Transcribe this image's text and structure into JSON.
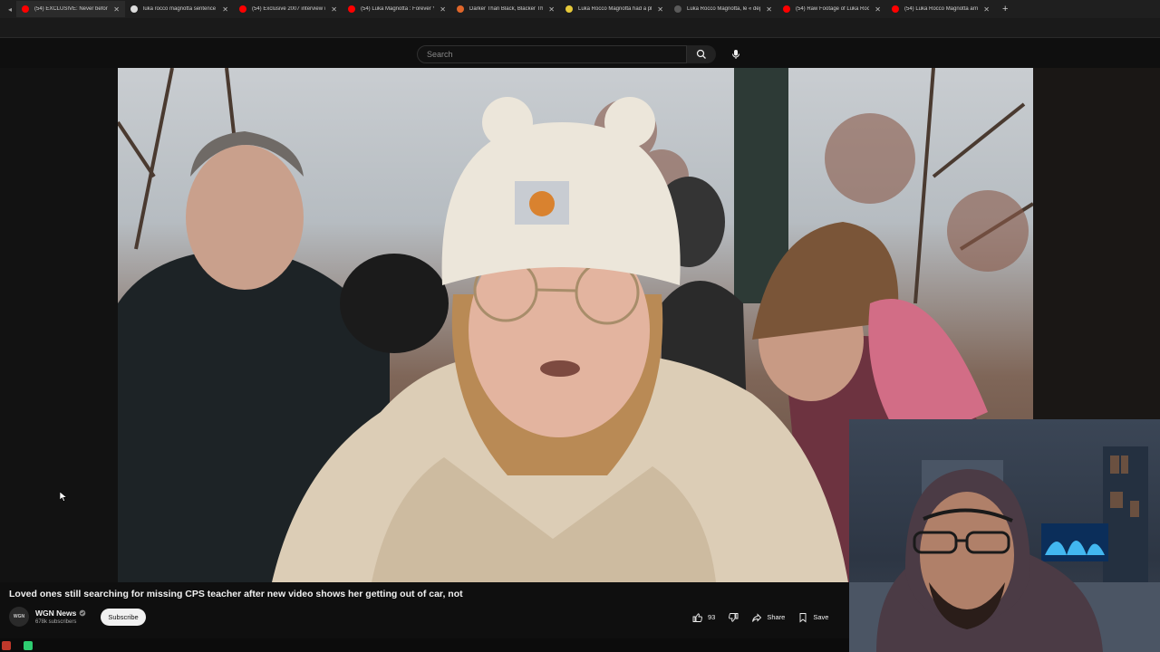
{
  "browser": {
    "tabs": [
      {
        "title": "(54) EXCLUSIVE: Never before",
        "favicon": "#ff0000",
        "active": true
      },
      {
        "title": "luka rocco magnotta sentence",
        "favicon": "#dddddd"
      },
      {
        "title": "(54) Exclusive 2007 interview w",
        "favicon": "#ff0000"
      },
      {
        "title": "(54) Luka Magnotta : Forever Yo",
        "favicon": "#ff0000"
      },
      {
        "title": "Darker Than Black, Blacker Th",
        "favicon": "#e0662a"
      },
      {
        "title": "Luka Rocco Magnotta had a pl",
        "favicon": "#e6c93a"
      },
      {
        "title": "Luka Rocco Magnotta, le « dép",
        "favicon": "#5a5a5a"
      },
      {
        "title": "(54) Raw Footage of Luka Rocc",
        "favicon": "#ff0000"
      },
      {
        "title": "(54) Luka Rocco Magnotta arriv",
        "favicon": "#ff0000"
      }
    ],
    "new_tab_label": "+"
  },
  "youtube": {
    "search": {
      "placeholder": "Search"
    },
    "video": {
      "title": "Loved ones still searching for missing CPS teacher after new video shows her getting out of car, not"
    },
    "channel": {
      "name": "WGN News",
      "subscribers": "678k subscribers",
      "avatar_text": "WGN",
      "subscribe_label": "Subscribe"
    },
    "actions": {
      "like_count": "93",
      "share_label": "Share",
      "save_label": "Save"
    }
  },
  "icons": {
    "search": "search-icon",
    "mic": "mic-icon",
    "like": "thumbs-up-icon",
    "dislike": "thumbs-down-icon",
    "share": "share-icon",
    "save": "bookmark-icon",
    "verified": "verified-icon"
  },
  "colors": {
    "background": "#0f0f0f",
    "subscribe_bg": "#f1f1f1",
    "youtube_red": "#ff0000"
  }
}
